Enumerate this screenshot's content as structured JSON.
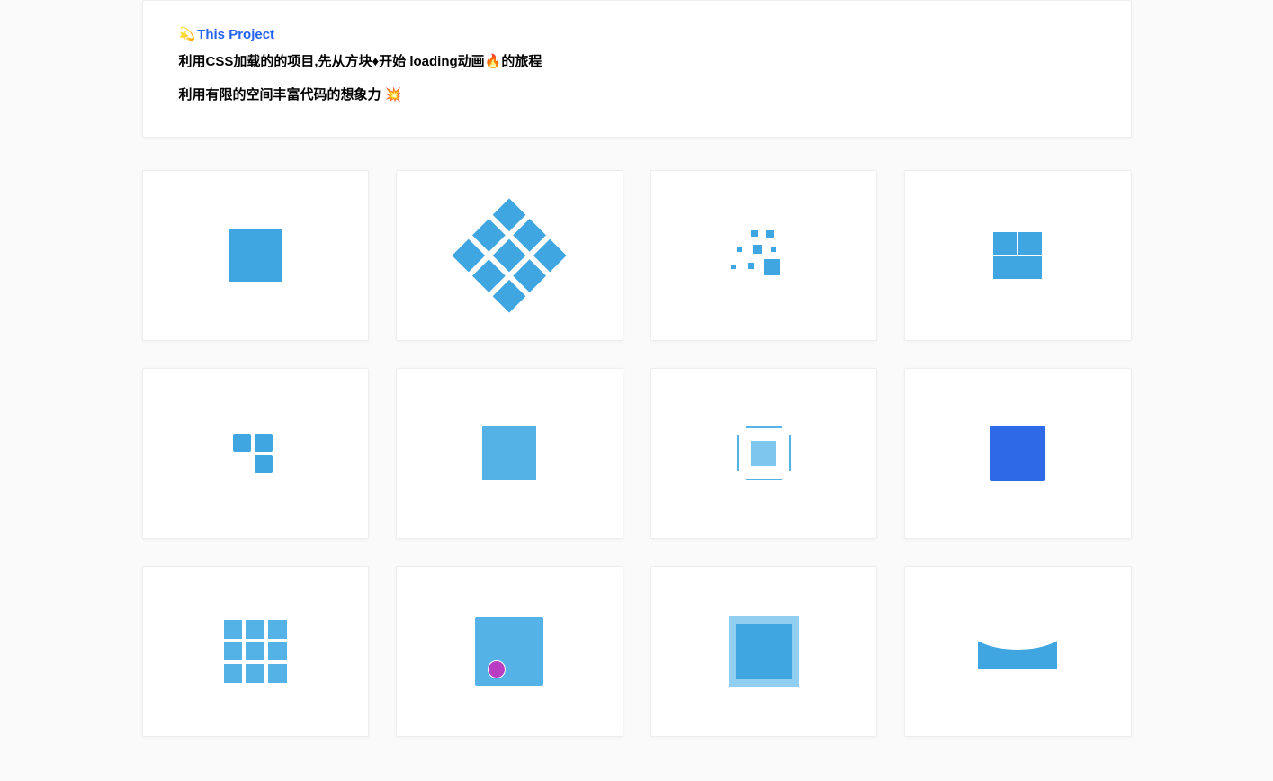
{
  "header": {
    "emoji_prefix": "💫",
    "title": "This Project",
    "line1": "利用CSS加载的的项目,先从方块♦开始 loading动画🔥的旅程",
    "line2": "利用有限的空间丰富代码的想象力 💥"
  },
  "cards": [
    {
      "name": "loader-solid-square"
    },
    {
      "name": "loader-diamond-grid"
    },
    {
      "name": "loader-pixel-scatter"
    },
    {
      "name": "loader-three-tile"
    },
    {
      "name": "loader-l-shape"
    },
    {
      "name": "loader-square-pulse"
    },
    {
      "name": "loader-bracket-square"
    },
    {
      "name": "loader-solid-blue"
    },
    {
      "name": "loader-3x3-grid"
    },
    {
      "name": "loader-square-dot"
    },
    {
      "name": "loader-concentric-square"
    },
    {
      "name": "loader-arc-wave"
    }
  ]
}
